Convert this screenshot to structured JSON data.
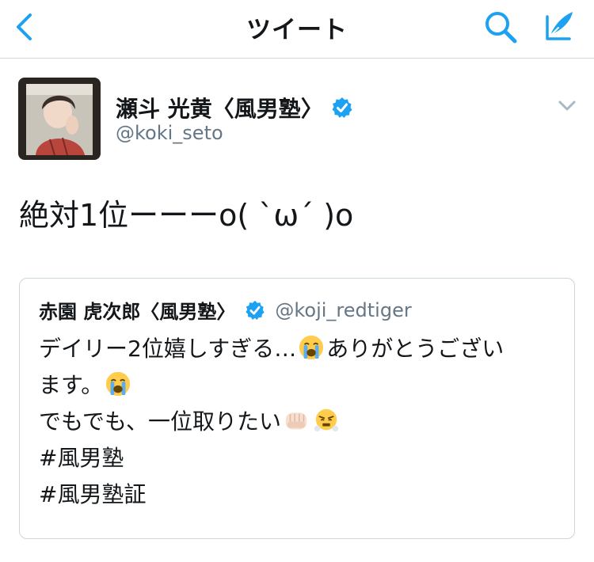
{
  "nav": {
    "title": "ツイート",
    "icons": {
      "back": "chevron-left-icon",
      "search": "search-icon",
      "compose": "compose-quill-icon"
    },
    "accent_color": "#1da1f2"
  },
  "tweet": {
    "author": {
      "display_name": "瀬斗 光黄〈風男塾〉",
      "handle": "@koki_seto",
      "verified": true
    },
    "text": "絶対1位ーーーo( ˋωˊ )o",
    "quoted": {
      "author": {
        "display_name": "赤園 虎次郎〈風男塾〉",
        "handle": "@koji_redtiger",
        "verified": true
      },
      "lines": [
        {
          "text": "デイリー2位嬉しすぎる…",
          "emoji_after": "loudly-crying-face-emoji",
          "text_after": "ありがとうござい"
        },
        {
          "text": "ます。",
          "emoji_after": "loudly-crying-face-emoji",
          "text_after": ""
        },
        {
          "text": "でもでも、一位取りたい",
          "emoji_after": "fist-and-steam-emoji",
          "text_after": ""
        },
        {
          "text": "#風男塾"
        },
        {
          "text": "#風男塾証"
        }
      ]
    }
  }
}
